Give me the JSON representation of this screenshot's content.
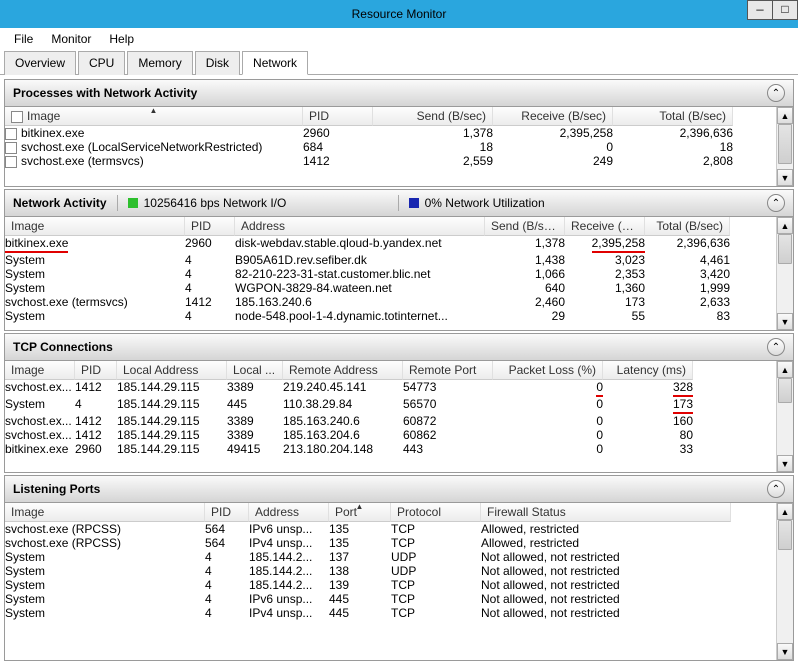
{
  "window": {
    "title": "Resource Monitor"
  },
  "menu": {
    "file": "File",
    "monitor": "Monitor",
    "help": "Help"
  },
  "tabs": {
    "overview": "Overview",
    "cpu": "CPU",
    "memory": "Memory",
    "disk": "Disk",
    "network": "Network"
  },
  "panels": {
    "processes": {
      "title": "Processes with Network Activity",
      "headers": {
        "image": "Image",
        "pid": "PID",
        "send": "Send (B/sec)",
        "receive": "Receive (B/sec)",
        "total": "Total (B/sec)"
      },
      "rows": [
        {
          "image": "bitkinex.exe",
          "pid": "2960",
          "send": "1,378",
          "receive": "2,395,258",
          "total": "2,396,636"
        },
        {
          "image": "svchost.exe (LocalServiceNetworkRestricted)",
          "pid": "684",
          "send": "18",
          "receive": "0",
          "total": "18"
        },
        {
          "image": "svchost.exe (termsvcs)",
          "pid": "1412",
          "send": "2,559",
          "receive": "249",
          "total": "2,808"
        }
      ]
    },
    "activity": {
      "title": "Network Activity",
      "status1": "10256416 bps Network I/O",
      "status2": "0% Network Utilization",
      "headers": {
        "image": "Image",
        "pid": "PID",
        "address": "Address",
        "send": "Send (B/sec)",
        "receive": "Receive (B...",
        "total": "Total (B/sec)"
      },
      "rows": [
        {
          "image": "bitkinex.exe",
          "pid": "2960",
          "address": "disk-webdav.stable.qloud-b.yandex.net",
          "send": "1,378",
          "receive": "2,395,258",
          "total": "2,396,636",
          "red_image": true,
          "red_receive": true
        },
        {
          "image": "System",
          "pid": "4",
          "address": "B905A61D.rev.sefiber.dk",
          "send": "1,438",
          "receive": "3,023",
          "total": "4,461"
        },
        {
          "image": "System",
          "pid": "4",
          "address": "82-210-223-31-stat.customer.blic.net",
          "send": "1,066",
          "receive": "2,353",
          "total": "3,420"
        },
        {
          "image": "System",
          "pid": "4",
          "address": "WGPON-3829-84.wateen.net",
          "send": "640",
          "receive": "1,360",
          "total": "1,999"
        },
        {
          "image": "svchost.exe (termsvcs)",
          "pid": "1412",
          "address": "185.163.240.6",
          "send": "2,460",
          "receive": "173",
          "total": "2,633"
        },
        {
          "image": "System",
          "pid": "4",
          "address": "node-548.pool-1-4.dynamic.totinternet...",
          "send": "29",
          "receive": "55",
          "total": "83"
        }
      ]
    },
    "tcp": {
      "title": "TCP Connections",
      "headers": {
        "image": "Image",
        "pid": "PID",
        "laddr": "Local Address",
        "lport": "Local ...",
        "raddr": "Remote Address",
        "rport": "Remote Port",
        "loss": "Packet Loss (%)",
        "latency": "Latency (ms)"
      },
      "rows": [
        {
          "image": "svchost.ex...",
          "pid": "1412",
          "laddr": "185.144.29.115",
          "lport": "3389",
          "raddr": "219.240.45.141",
          "rport": "54773",
          "loss": "0",
          "latency": "328",
          "red_loss": true,
          "red_latency": true
        },
        {
          "image": "System",
          "pid": "4",
          "laddr": "185.144.29.115",
          "lport": "445",
          "raddr": "110.38.29.84",
          "rport": "56570",
          "loss": "0",
          "latency": "173",
          "red_latency": true
        },
        {
          "image": "svchost.ex...",
          "pid": "1412",
          "laddr": "185.144.29.115",
          "lport": "3389",
          "raddr": "185.163.240.6",
          "rport": "60872",
          "loss": "0",
          "latency": "160"
        },
        {
          "image": "svchost.ex...",
          "pid": "1412",
          "laddr": "185.144.29.115",
          "lport": "3389",
          "raddr": "185.163.204.6",
          "rport": "60862",
          "loss": "0",
          "latency": "80"
        },
        {
          "image": "bitkinex.exe",
          "pid": "2960",
          "laddr": "185.144.29.115",
          "lport": "49415",
          "raddr": "213.180.204.148",
          "rport": "443",
          "loss": "0",
          "latency": "33"
        }
      ]
    },
    "listening": {
      "title": "Listening Ports",
      "headers": {
        "image": "Image",
        "pid": "PID",
        "address": "Address",
        "port": "Port",
        "protocol": "Protocol",
        "firewall": "Firewall Status"
      },
      "rows": [
        {
          "image": "svchost.exe (RPCSS)",
          "pid": "564",
          "address": "IPv6 unsp...",
          "port": "135",
          "protocol": "TCP",
          "firewall": "Allowed, restricted"
        },
        {
          "image": "svchost.exe (RPCSS)",
          "pid": "564",
          "address": "IPv4 unsp...",
          "port": "135",
          "protocol": "TCP",
          "firewall": "Allowed, restricted"
        },
        {
          "image": "System",
          "pid": "4",
          "address": "185.144.2...",
          "port": "137",
          "protocol": "UDP",
          "firewall": "Not allowed, not restricted"
        },
        {
          "image": "System",
          "pid": "4",
          "address": "185.144.2...",
          "port": "138",
          "protocol": "UDP",
          "firewall": "Not allowed, not restricted"
        },
        {
          "image": "System",
          "pid": "4",
          "address": "185.144.2...",
          "port": "139",
          "protocol": "TCP",
          "firewall": "Not allowed, not restricted"
        },
        {
          "image": "System",
          "pid": "4",
          "address": "IPv6 unsp...",
          "port": "445",
          "protocol": "TCP",
          "firewall": "Not allowed, not restricted"
        },
        {
          "image": "System",
          "pid": "4",
          "address": "IPv4 unsp...",
          "port": "445",
          "protocol": "TCP",
          "firewall": "Not allowed, not restricted"
        }
      ]
    }
  },
  "colors": {
    "green": "#2dbf2d",
    "blue": "#1826b0"
  }
}
